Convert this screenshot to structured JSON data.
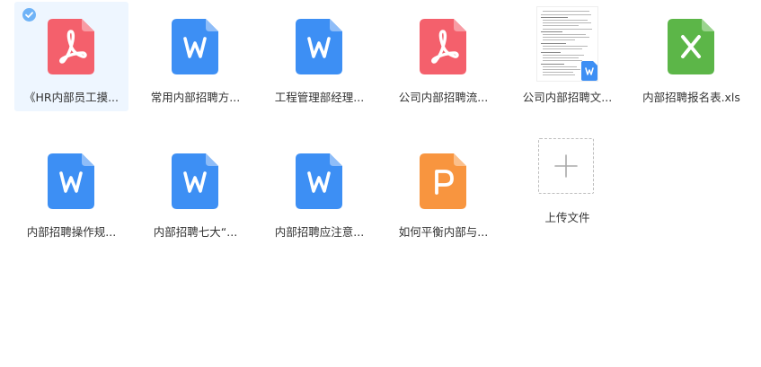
{
  "files_row1": [
    {
      "name": "《HR内部员工摸...",
      "type": "pdf",
      "selected": true
    },
    {
      "name": "常用内部招聘方...",
      "type": "word",
      "selected": false
    },
    {
      "name": "工程管理部经理...",
      "type": "word",
      "selected": false
    },
    {
      "name": "公司内部招聘流...",
      "type": "pdf",
      "selected": false
    },
    {
      "name": "公司内部招聘文...",
      "type": "word-preview",
      "selected": false
    },
    {
      "name": "内部招聘报名表.xls",
      "type": "excel",
      "selected": false
    }
  ],
  "files_row2": [
    {
      "name": "内部招聘操作规...",
      "type": "word",
      "selected": false
    },
    {
      "name": "内部招聘七大“...",
      "type": "word",
      "selected": false
    },
    {
      "name": "内部招聘应注意...",
      "type": "word",
      "selected": false
    },
    {
      "name": "如何平衡内部与...",
      "type": "ppt",
      "selected": false
    }
  ],
  "upload": {
    "label": "上传文件"
  },
  "colors": {
    "pdf": "#f4606c",
    "word": "#3d8ff4",
    "excel": "#5cb648",
    "ppt": "#f8953f",
    "selected_bg": "#eef6ff",
    "check": "#6fb3f7"
  }
}
